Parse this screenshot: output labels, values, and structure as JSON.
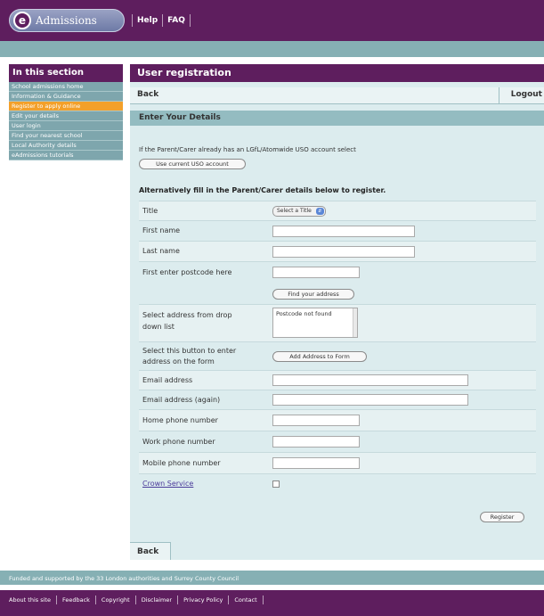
{
  "app": {
    "logo_letter": "e",
    "logo_text": "Admissions"
  },
  "top_nav": [
    "Help",
    "FAQ"
  ],
  "sidebar": {
    "heading": "In this section",
    "items": [
      {
        "label": "School admissions home",
        "active": false
      },
      {
        "label": "Information & Guidance",
        "active": false
      },
      {
        "label": "Register to apply online",
        "active": true
      },
      {
        "label": "Edit your details",
        "active": false
      },
      {
        "label": "User login",
        "active": false
      },
      {
        "label": "Find your nearest school",
        "active": false
      },
      {
        "label": "Local Authority details",
        "active": false
      },
      {
        "label": "eAdmissions tutorials",
        "active": false
      }
    ]
  },
  "main": {
    "title": "User registration",
    "back_label": "Back",
    "logout_label": "Logout",
    "section_title": "Enter Your Details",
    "usd_info": "If the Parent/Carer already has an LGfL/Atomwide USO account select",
    "use_usd_button": "Use current USO account",
    "alt_heading": "Alternatively fill in the Parent/Carer details below to register.",
    "form": {
      "title_label": "Title",
      "title_select": "Select a Title",
      "first_name_label": "First name",
      "last_name_label": "Last name",
      "postcode_label": "First enter postcode here",
      "find_address_button": "Find your address",
      "select_address_label_1": "Select address from drop",
      "select_address_label_2": "down list",
      "address_list_value": "Postcode not found",
      "add_address_label_1": "Select this button to enter",
      "add_address_label_2": "address on the form",
      "add_address_button": "Add Address to Form",
      "email_label": "Email address",
      "email_again_label": "Email address (again)",
      "home_phone_label": "Home phone number",
      "work_phone_label": "Work phone number",
      "mobile_phone_label": "Mobile phone number",
      "crown_service_label": "Crown Service"
    },
    "register_button": "Register",
    "back_bottom_label": "Back"
  },
  "footer": {
    "funding_text": "Funded and supported by the 33 London authorities and Surrey County Council",
    "links": [
      "About this site",
      "Feedback",
      "Copyright",
      "Disclaimer",
      "Privacy Policy",
      "Contact"
    ]
  },
  "colors": {
    "brand_purple": "#5e1e5e",
    "teal": "#86b0b4",
    "active_orange": "#f3a02a",
    "panel": "#dcecee"
  }
}
